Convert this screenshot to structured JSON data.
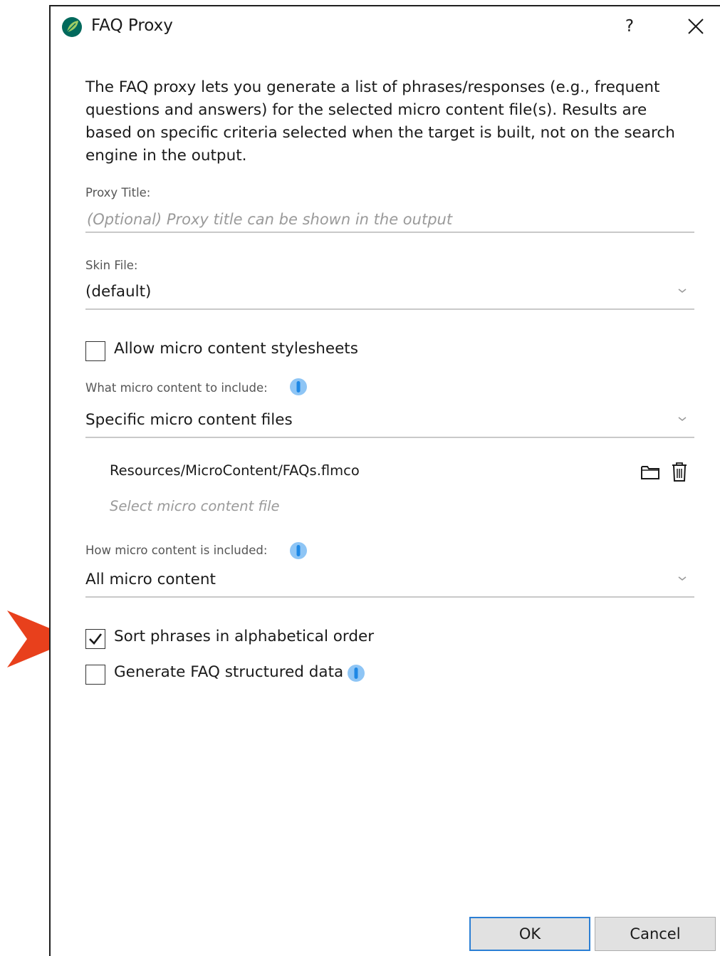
{
  "window": {
    "title": "FAQ Proxy",
    "help_label": "?"
  },
  "description": "The FAQ proxy lets you generate a list of phrases/responses (e.g., frequent questions and answers) for the selected micro content file(s). Results are based on specific criteria selected when the target is built, not on the search engine in the output.",
  "proxy_title": {
    "label": "Proxy Title:",
    "value": "",
    "placeholder": "(Optional) Proxy title can be shown in the output"
  },
  "skin_file": {
    "label": "Skin File:",
    "value": "(default)"
  },
  "allow_stylesheets": {
    "label": "Allow micro content stylesheets",
    "checked": false
  },
  "what_to_include": {
    "label": "What micro content to include:",
    "value": "Specific micro content files",
    "files": [
      "Resources/MicroContent/FAQs.flmco"
    ],
    "select_placeholder": "Select micro content file"
  },
  "how_included": {
    "label": "How micro content is included:",
    "value": "All micro content"
  },
  "sort_alphabetical": {
    "label": "Sort phrases in alphabetical order",
    "checked": true
  },
  "generate_faq": {
    "label": "Generate FAQ structured data",
    "checked": false
  },
  "buttons": {
    "ok": "OK",
    "cancel": "Cancel"
  },
  "colors": {
    "info_blue": "#1e88e5",
    "focus_border": "#2b7fd4",
    "arrow": "#e8401c",
    "logo_green": "#7cb342",
    "logo_teal": "#00695c"
  },
  "icons": [
    "app-logo-icon",
    "help-icon",
    "close-icon",
    "chevron-down-icon",
    "info-icon",
    "folder-icon",
    "trash-icon",
    "checkmark-icon",
    "callout-arrow-icon"
  ]
}
